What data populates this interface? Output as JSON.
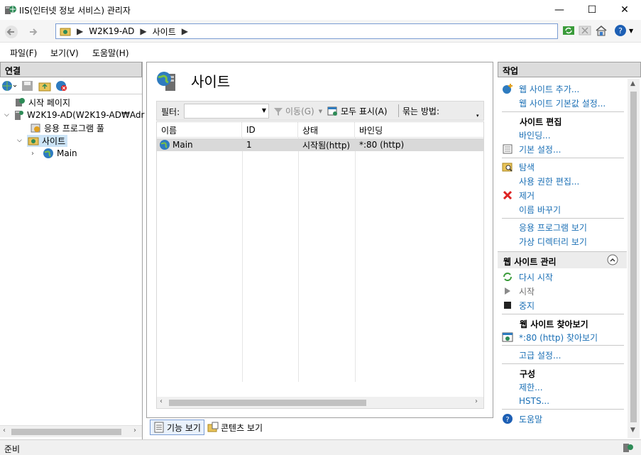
{
  "window": {
    "title": "IIS(인터넷 정보 서비스) 관리자",
    "minimize": "—",
    "maximize": "☐",
    "close": "✕"
  },
  "address": {
    "crumbs": [
      "W2K19-AD",
      "사이트"
    ]
  },
  "menu": [
    "파일(F)",
    "보기(V)",
    "도움말(H)"
  ],
  "connections": {
    "header": "연결",
    "tree": [
      {
        "label": "시작 페이지",
        "icon": "start-page-icon"
      },
      {
        "label": "W2K19-AD(W2K19-AD₩Adr",
        "icon": "server-icon"
      },
      {
        "label": "응용 프로그램 풀",
        "icon": "app-pool-icon"
      },
      {
        "label": "사이트",
        "icon": "sites-folder-icon"
      },
      {
        "label": "Main",
        "icon": "globe-icon"
      }
    ]
  },
  "center": {
    "title": "사이트",
    "filter_label": "필터:",
    "go_label": "이동(G)",
    "show_all_label": "모두 표시(A)",
    "group_by_label": "묶는 방법:",
    "columns": [
      "이름",
      "ID",
      "상태",
      "바인딩"
    ],
    "rows": [
      {
        "name": "Main",
        "id": "1",
        "status": "시작됨(http)",
        "binding": "*:80 (http)"
      }
    ],
    "tabs": [
      "기능 보기",
      "콘텐츠 보기"
    ]
  },
  "actions": {
    "header": "작업",
    "top": [
      "웹 사이트 추가...",
      "웹 사이트 기본값 설정..."
    ],
    "edit_site": {
      "title": "사이트 편집",
      "items": [
        "바인딩...",
        "기본 설정...",
        "탐색",
        "사용 권한 편집...",
        "제거",
        "이름 바꾸기",
        "응용 프로그램 보기",
        "가상 디렉터리 보기"
      ]
    },
    "manage_site": {
      "title": "웹 사이트 관리",
      "items": [
        "다시 시작",
        "시작",
        "중지"
      ]
    },
    "browse_site": {
      "title": "웹 사이트 찾아보기",
      "items": [
        "*:80 (http) 찾아보기"
      ],
      "advanced": "고급 설정..."
    },
    "config": {
      "title": "구성",
      "items": [
        "제한...",
        "HSTS..."
      ]
    },
    "help": "도움말"
  },
  "status": {
    "text": "준비"
  },
  "colors": {
    "link": "#1a6fb5",
    "header_bg": "#dcdcdc",
    "selection": "#cce4f7",
    "row_selected": "#d9d9d9"
  }
}
